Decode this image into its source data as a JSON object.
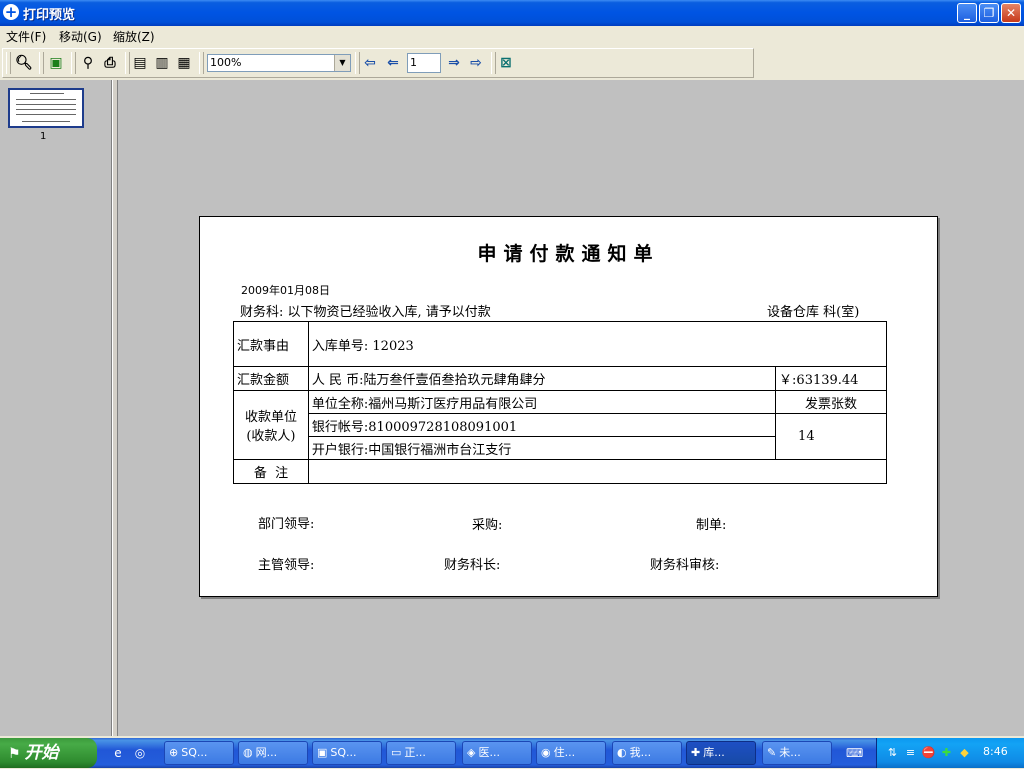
{
  "window": {
    "title": "打印预览",
    "controls": {
      "minimize": "_",
      "restore": "❐",
      "close": "✕"
    }
  },
  "menu": [
    {
      "label": "文件(F)"
    },
    {
      "label": "移动(G)"
    },
    {
      "label": "缩放(Z)"
    }
  ],
  "toolbar": {
    "zoom_value": "100%",
    "page_value": "1"
  },
  "thumbnail": {
    "page_number": "1"
  },
  "document": {
    "title": "申请付款通知单",
    "date": "2009年01月08日",
    "notice": "财务科: 以下物资已经验收入库, 请予以付款",
    "department": "设备仓库 科(室)",
    "rows": {
      "reason_label": "汇款事由",
      "reason_value": "入库单号: 12023",
      "amount_label": "汇款金额",
      "amount_words": "人 民 币:陆万叁仟壹佰叁拾玖元肆角肆分",
      "amount_number": "￥:63139.44",
      "payee_label_1": "收款单位",
      "payee_label_2": "(收款人)",
      "payee_name": "单位全称:福州马斯汀医疗用品有限公司",
      "invoice_label": "发票张数",
      "account": "银行帐号:810009728108091001",
      "invoice_count": "14",
      "bank": "开户银行:中国银行福洲市台江支行",
      "remark_label": "备  注",
      "remark_value": ""
    },
    "signatures": {
      "dept_leader": "部门领导:",
      "purchasing": "采购:",
      "prepared_by": "制单:",
      "supervisor": "主管领导:",
      "finance_chief": "财务科长:",
      "finance_review": "财务科审核:"
    }
  },
  "taskbar": {
    "start_label": "开始",
    "tasks": [
      {
        "label": "SQ...",
        "icon": "⊕"
      },
      {
        "label": "网...",
        "icon": "◍"
      },
      {
        "label": "SQ...",
        "icon": "▣"
      },
      {
        "label": "正...",
        "icon": "▭"
      },
      {
        "label": "医...",
        "icon": "◈"
      },
      {
        "label": "住...",
        "icon": "◉"
      },
      {
        "label": "我...",
        "icon": "◐"
      },
      {
        "label": "库...",
        "icon": "✚"
      },
      {
        "label": "未...",
        "icon": "✎"
      }
    ],
    "clock": "8:46"
  },
  "colors": {
    "titlebar": "#0054e3",
    "preview_background": "#c0c0c0",
    "taskbar": "#245edb",
    "start_button": "#3c9a3c"
  }
}
